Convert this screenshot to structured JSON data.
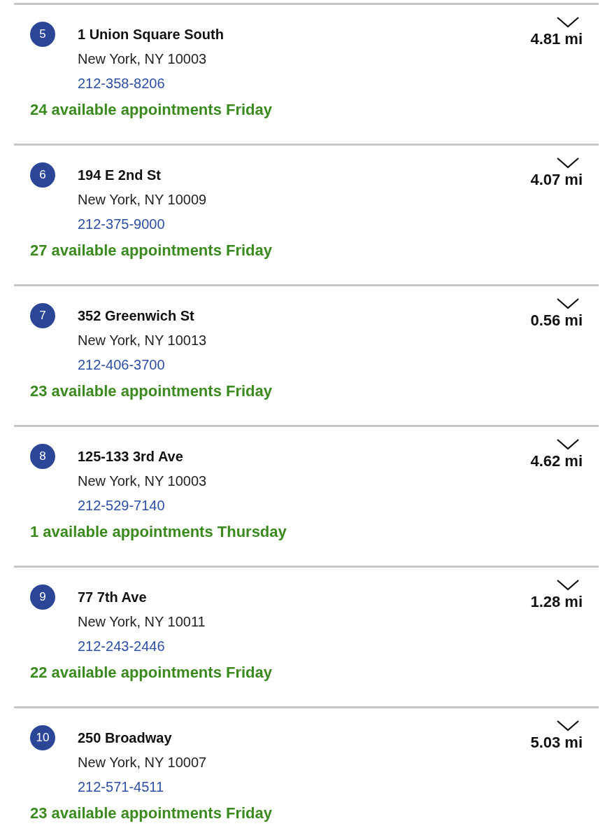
{
  "locations": [
    {
      "number": "5",
      "address": "1 Union Square South",
      "city": "New York, NY 10003",
      "phone": "212-358-8206",
      "availability": "24 available appointments Friday",
      "distance": "4.81 mi",
      "expanded": false
    },
    {
      "number": "6",
      "address": "194 E 2nd St",
      "city": "New York, NY 10009",
      "phone": "212-375-9000",
      "availability": "27 available appointments Friday",
      "distance": "4.07 mi",
      "expanded": false
    },
    {
      "number": "7",
      "address": "352 Greenwich St",
      "city": "New York, NY 10013",
      "phone": "212-406-3700",
      "availability": "23 available appointments Friday",
      "distance": "0.56 mi",
      "expanded": false
    },
    {
      "number": "8",
      "address": "125-133 3rd Ave",
      "city": "New York, NY 10003",
      "phone": "212-529-7140",
      "availability": "1 available appointments Thursday",
      "distance": "4.62 mi",
      "expanded": false
    },
    {
      "number": "9",
      "address": "77 7th Ave",
      "city": "New York, NY 10011",
      "phone": "212-243-2446",
      "availability": "22 available appointments Friday",
      "distance": "1.28 mi",
      "expanded": false
    },
    {
      "number": "10",
      "address": "250 Broadway",
      "city": "New York, NY 10007",
      "phone": "212-571-4511",
      "availability": "23 available appointments Friday",
      "distance": "5.03 mi",
      "expanded": false
    }
  ]
}
